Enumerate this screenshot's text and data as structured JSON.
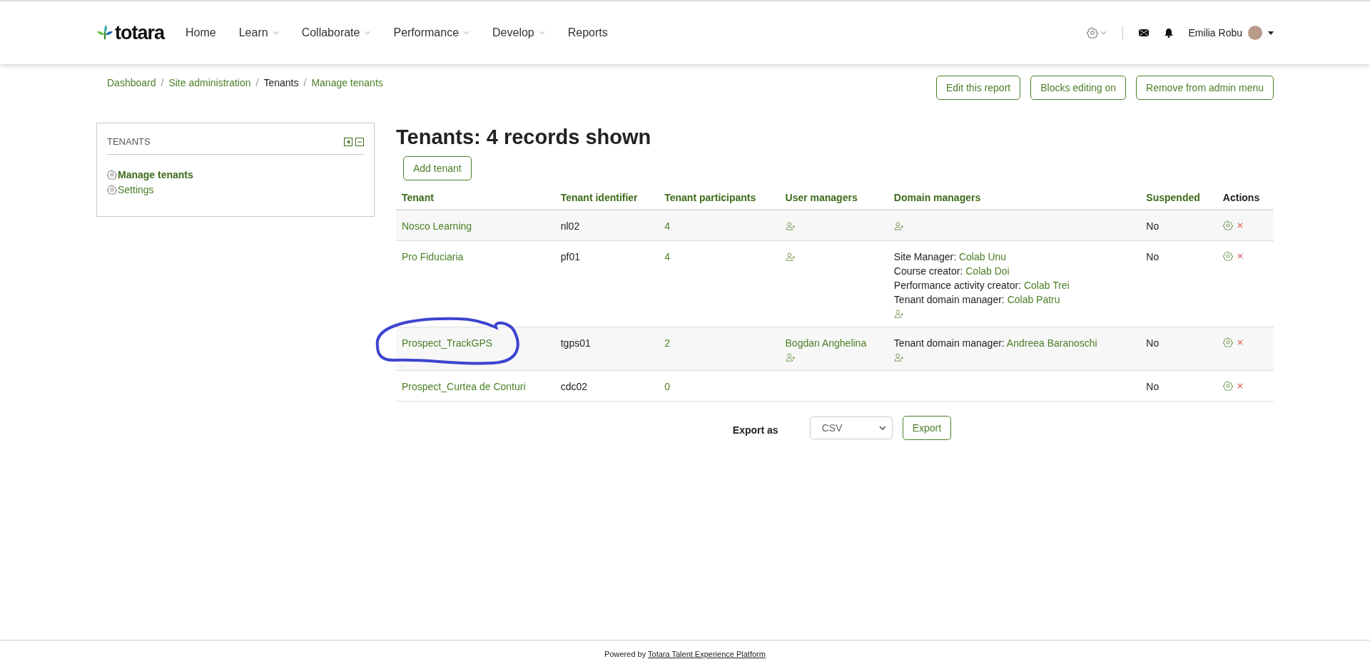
{
  "header": {
    "logo": "totara",
    "nav": [
      {
        "label": "Home",
        "has_menu": false
      },
      {
        "label": "Learn",
        "has_menu": true
      },
      {
        "label": "Collaborate",
        "has_menu": true
      },
      {
        "label": "Performance",
        "has_menu": true
      },
      {
        "label": "Develop",
        "has_menu": true
      },
      {
        "label": "Reports",
        "has_menu": false
      }
    ],
    "user": {
      "name": "Emilia Robu"
    }
  },
  "breadcrumb": [
    {
      "label": "Dashboard",
      "link": true
    },
    {
      "separator": "/",
      "label": "Site administration",
      "link": true
    },
    {
      "separator": "/",
      "label": "Tenants",
      "link": false
    },
    {
      "separator": "/",
      "label": "Manage tenants",
      "link": true
    }
  ],
  "page_buttons": [
    "Edit this report",
    "Blocks editing on",
    "Remove from admin menu"
  ],
  "sidebar": {
    "title": "TENANTS",
    "items": [
      {
        "label": "Manage tenants",
        "selected": true
      },
      {
        "label": "Settings",
        "selected": false
      }
    ]
  },
  "main": {
    "title": "Tenants: 4 records shown",
    "add_button": "Add tenant",
    "table": {
      "columns": [
        {
          "label": "Tenant",
          "sortable": true
        },
        {
          "label": "Tenant identifier",
          "sortable": true
        },
        {
          "label": "Tenant participants",
          "sortable": true
        },
        {
          "label": "User managers",
          "sortable": true
        },
        {
          "label": "Domain managers",
          "sortable": true
        },
        {
          "label": "Suspended",
          "sortable": true
        },
        {
          "label": "Actions",
          "sortable": false
        }
      ],
      "rows": [
        {
          "tenant": "Nosco Learning",
          "identifier": "nl02",
          "participants": "4",
          "user_managers": [],
          "add_user_manager": true,
          "domain_managers": [],
          "add_domain_manager": true,
          "suspended": "No",
          "highlighted": false
        },
        {
          "tenant": "Pro Fiduciaria",
          "identifier": "pf01",
          "participants": "4",
          "user_managers": [],
          "add_user_manager": true,
          "domain_managers": [
            {
              "role": "Site Manager:",
              "name": "Colab Unu"
            },
            {
              "role": "Course creator:",
              "name": "Colab Doi"
            },
            {
              "role": "Performance activity creator:",
              "name": "Colab Trei"
            },
            {
              "role": "Tenant domain manager:",
              "name": "Colab Patru"
            }
          ],
          "add_domain_manager": true,
          "suspended": "No",
          "highlighted": false
        },
        {
          "tenant": "Prospect_TrackGPS",
          "identifier": "tgps01",
          "participants": "2",
          "user_managers": [
            "Bogdan Anghelina"
          ],
          "add_user_manager": true,
          "domain_managers": [
            {
              "role": "Tenant domain manager:",
              "name": "Andreea Baranoschi"
            }
          ],
          "add_domain_manager": true,
          "suspended": "No",
          "highlighted": true
        },
        {
          "tenant": "Prospect_Curtea de Conturi",
          "identifier": "cdc02",
          "participants": "0",
          "user_managers": [],
          "add_user_manager": false,
          "domain_managers": [],
          "add_domain_manager": false,
          "suspended": "No",
          "highlighted": false
        }
      ]
    },
    "export": {
      "label": "Export as",
      "format": "CSV",
      "button": "Export"
    }
  },
  "footer": {
    "prefix": "Powered by",
    "link": "Totara Talent Experience Platform"
  }
}
